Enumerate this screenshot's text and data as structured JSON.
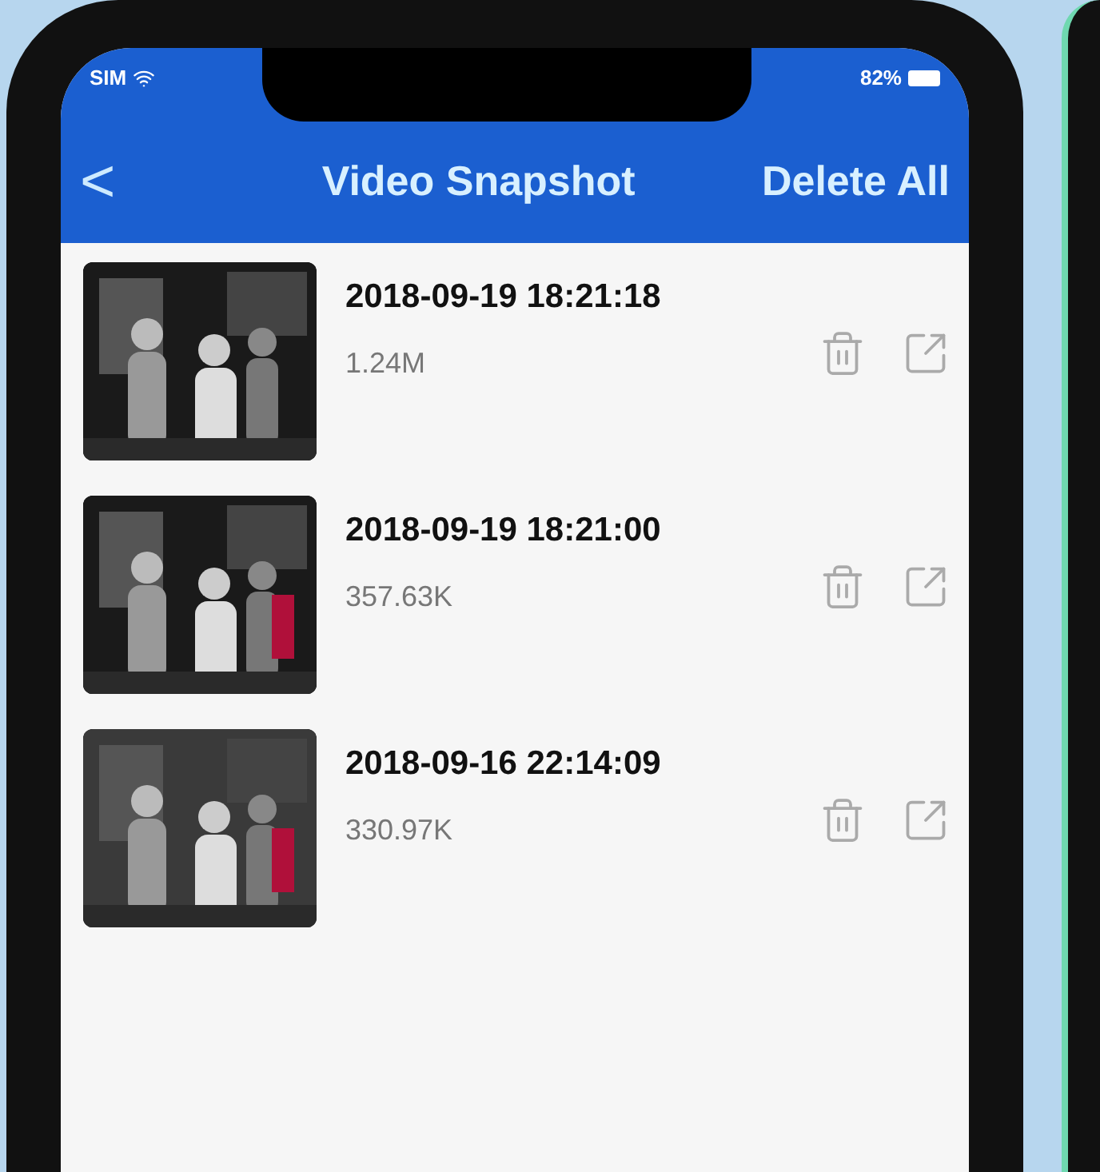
{
  "status_bar": {
    "carrier": "SIM",
    "battery": "82%"
  },
  "nav_bar": {
    "back": "<",
    "title": "Video Snapshot",
    "action": "Delete All"
  },
  "snapshots": [
    {
      "time": "2018-09-19 18:21:18",
      "size": "1.24M"
    },
    {
      "time": "2018-09-19 18:21:00",
      "size": "357.63K"
    },
    {
      "time": "2018-09-16 22:14:09",
      "size": "330.97K"
    }
  ]
}
